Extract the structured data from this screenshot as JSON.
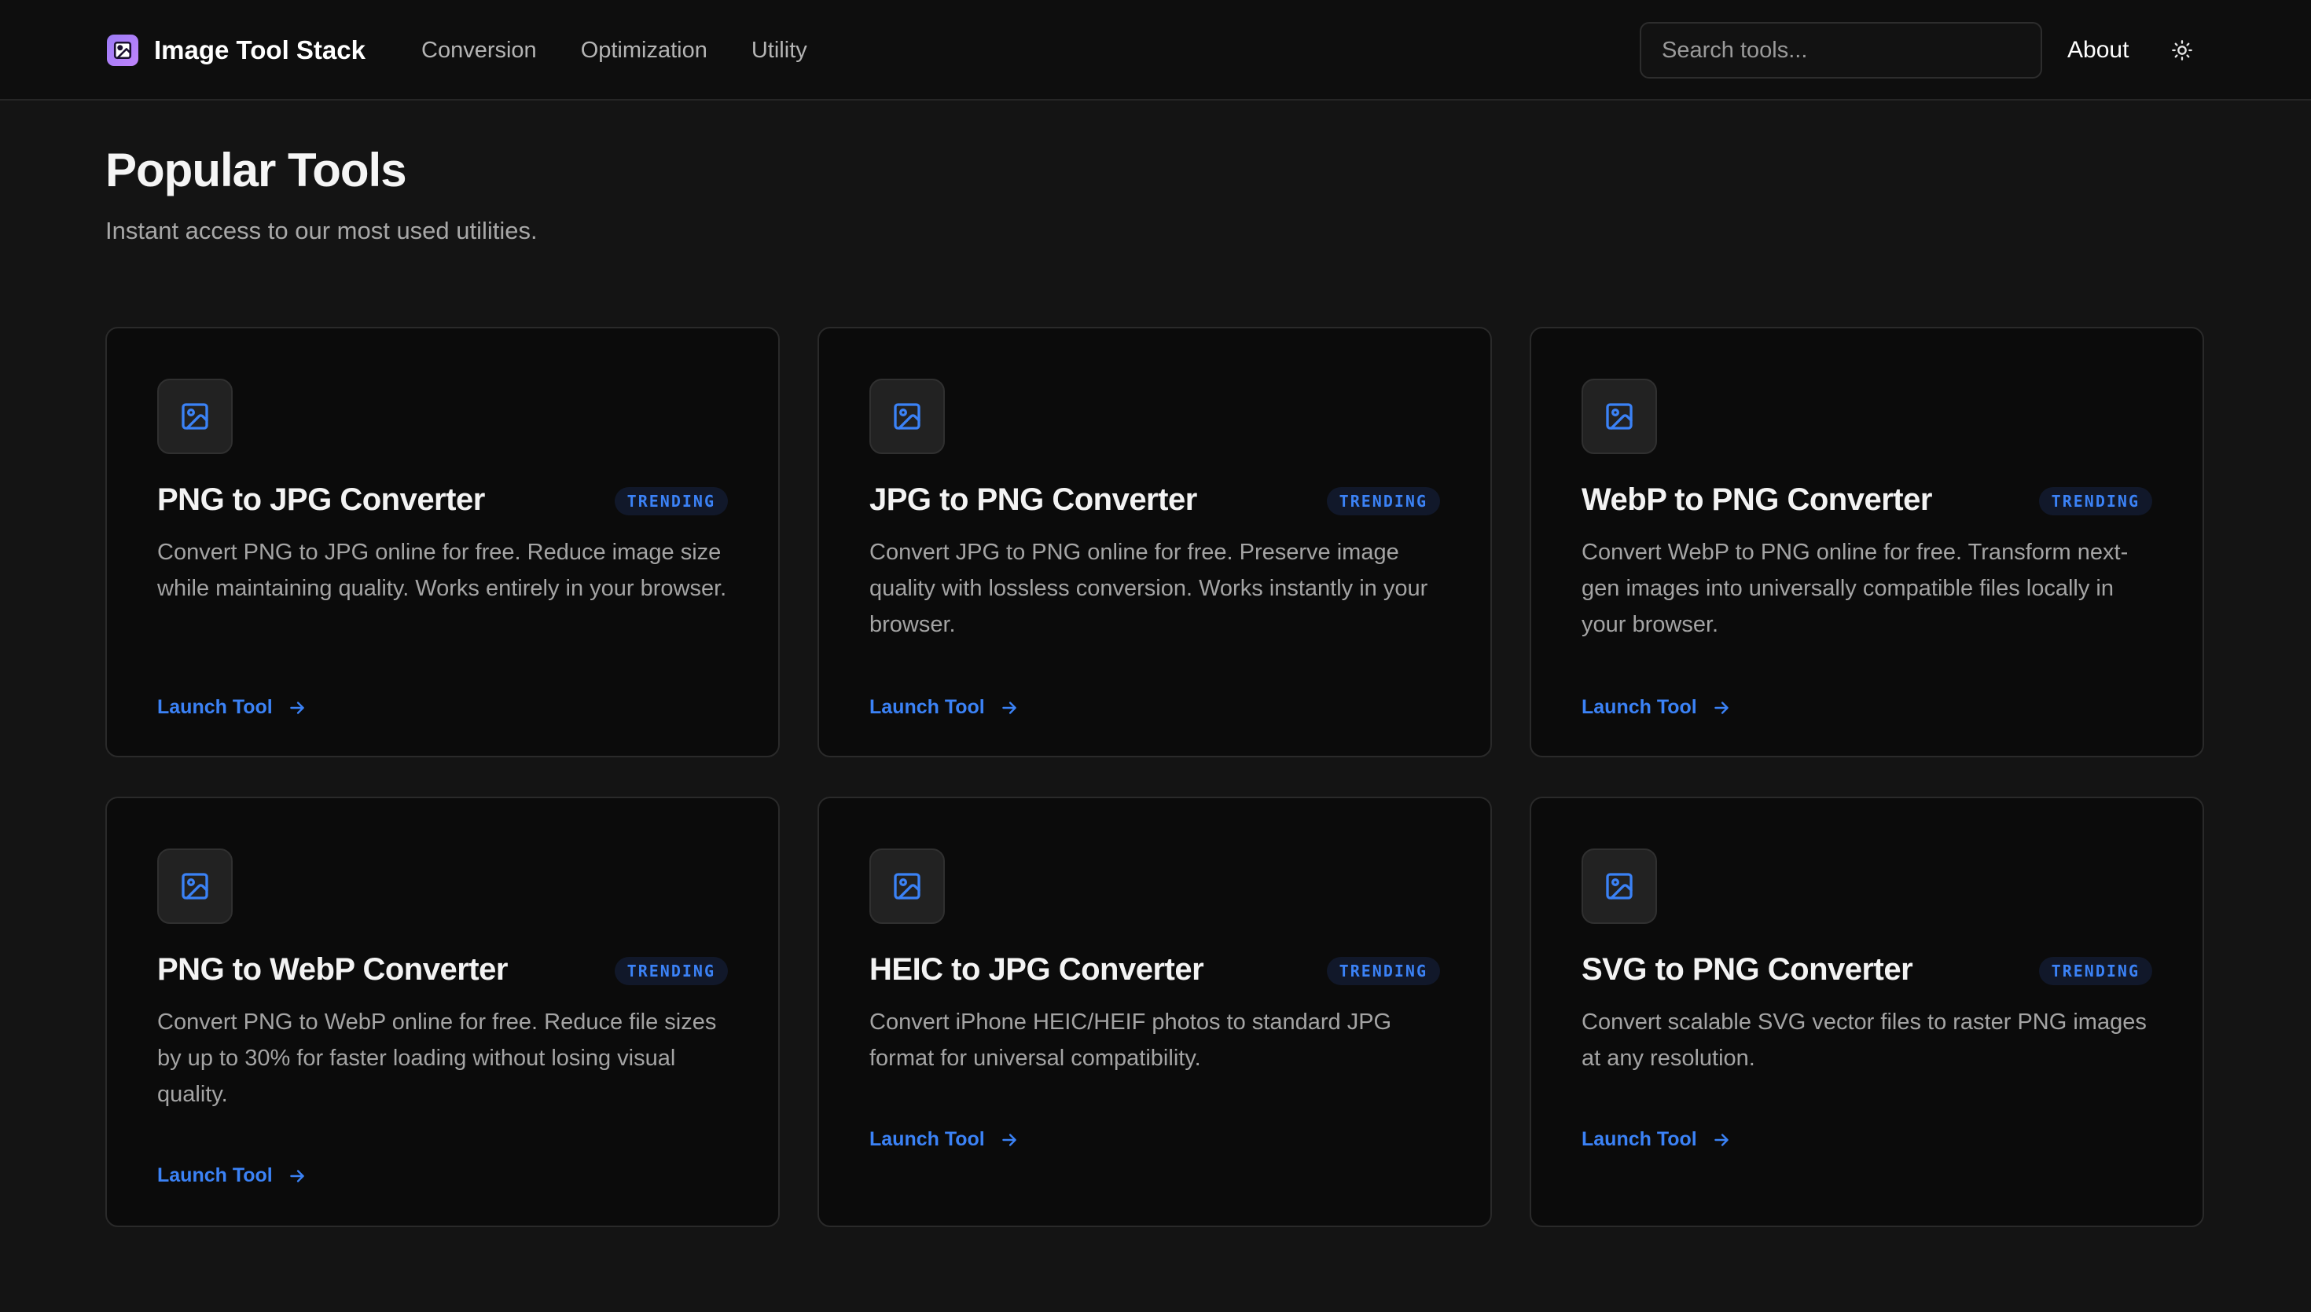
{
  "header": {
    "brand_name": "Image Tool Stack",
    "brand_icon": "image-icon",
    "nav": [
      {
        "label": "Conversion"
      },
      {
        "label": "Optimization"
      },
      {
        "label": "Utility"
      }
    ],
    "search_placeholder": "Search tools...",
    "about_label": "About",
    "theme_icon": "sun-icon"
  },
  "main": {
    "title": "Popular Tools",
    "subtitle": "Instant access to our most used utilities."
  },
  "colors": {
    "accent": "#3b82f6",
    "background": "#141414",
    "card_background": "#0b0b0b",
    "brand_gradient_start": "#9b7bf5",
    "brand_gradient_end": "#c084fc"
  },
  "tools": [
    {
      "title": "PNG to JPG Converter",
      "badge": "TRENDING",
      "icon": "image-icon",
      "description": "Convert PNG to JPG online for free. Reduce image size while maintaining quality. Works entirely in your browser.",
      "link_label": "Launch Tool"
    },
    {
      "title": "JPG to PNG Converter",
      "badge": "TRENDING",
      "icon": "image-icon",
      "description": "Convert JPG to PNG online for free. Preserve image quality with lossless conversion. Works instantly in your browser.",
      "link_label": "Launch Tool"
    },
    {
      "title": "WebP to PNG Converter",
      "badge": "TRENDING",
      "icon": "image-icon",
      "description": "Convert WebP to PNG online for free. Transform next-gen images into universally compatible files locally in your browser.",
      "link_label": "Launch Tool"
    },
    {
      "title": "PNG to WebP Converter",
      "badge": "TRENDING",
      "icon": "image-icon",
      "description": "Convert PNG to WebP online for free. Reduce file sizes by up to 30% for faster loading without losing visual quality.",
      "link_label": "Launch Tool"
    },
    {
      "title": "HEIC to JPG Converter",
      "badge": "TRENDING",
      "icon": "image-icon",
      "description": "Convert iPhone HEIC/HEIF photos to standard JPG format for universal compatibility.",
      "link_label": "Launch Tool"
    },
    {
      "title": "SVG to PNG Converter",
      "badge": "TRENDING",
      "icon": "image-icon",
      "description": "Convert scalable SVG vector files to raster PNG images at any resolution.",
      "link_label": "Launch Tool"
    }
  ]
}
